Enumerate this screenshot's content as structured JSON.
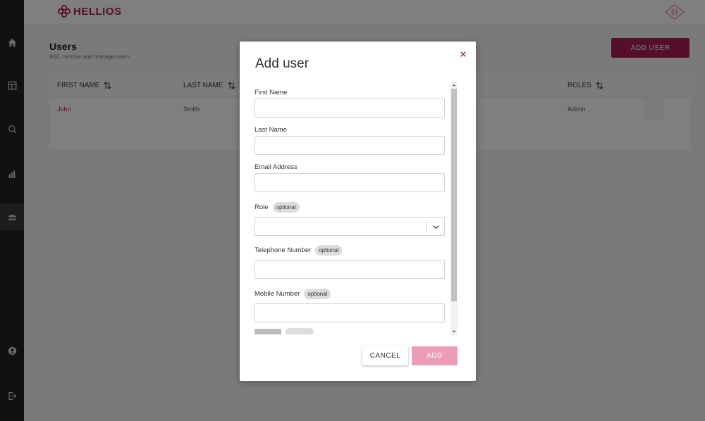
{
  "app": {
    "brand": "HELLIOS",
    "accent_color": "#a81e55"
  },
  "sidebar": {
    "items": [
      {
        "icon": "home-icon"
      },
      {
        "icon": "dashboard-icon"
      },
      {
        "icon": "search-icon"
      },
      {
        "icon": "analytics-icon"
      },
      {
        "icon": "users-icon",
        "active": true
      },
      {
        "icon": "account-icon"
      },
      {
        "icon": "logout-icon"
      }
    ]
  },
  "page": {
    "title": "Users",
    "subtitle": "Add, remove and manage users.",
    "add_user_label": "ADD USER"
  },
  "table": {
    "columns": [
      "FIRST NAME",
      "LAST NAME",
      "ROLES"
    ],
    "rows": [
      {
        "first_name": "John",
        "last_name": "Smith",
        "roles": "Admin"
      }
    ]
  },
  "modal": {
    "title": "Add user",
    "close_icon": "close-icon",
    "optional_badge": "optional",
    "fields": {
      "first_name": {
        "label": "First Name",
        "value": ""
      },
      "last_name": {
        "label": "Last Name",
        "value": ""
      },
      "email": {
        "label": "Email Address",
        "value": ""
      },
      "role": {
        "label": "Role",
        "value": ""
      },
      "telephone": {
        "label": "Telephone Number",
        "value": ""
      },
      "mobile": {
        "label": "Mobile Number",
        "value": ""
      }
    },
    "cancel_label": "CANCEL",
    "add_label": "ADD"
  }
}
